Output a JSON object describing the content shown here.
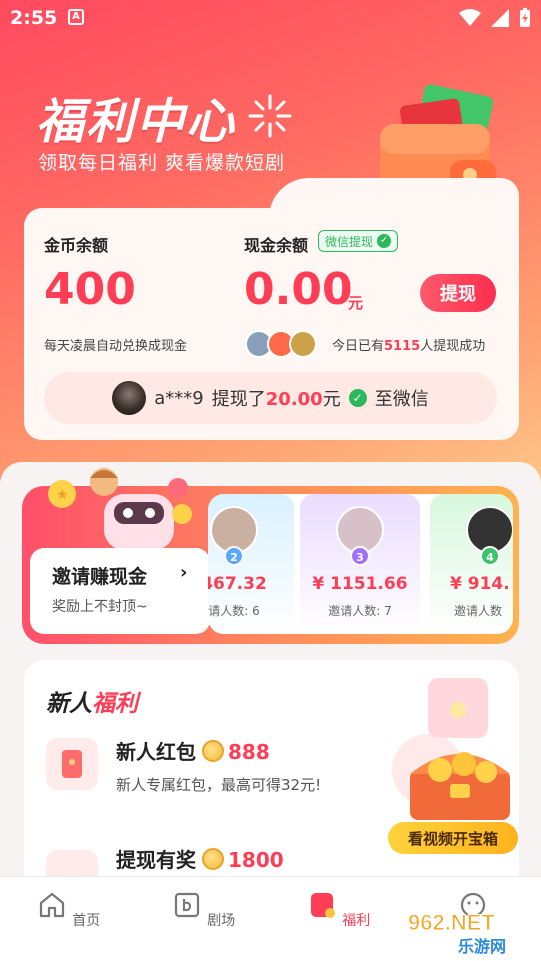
{
  "status_bar": {
    "time": "2:55",
    "a_icon": "A"
  },
  "hero": {
    "title": "福利中心",
    "subtitle": "领取每日福利 爽看爆款短剧"
  },
  "balance": {
    "coin_label": "金币余额",
    "coin_value": "400",
    "coin_note": "每天凌晨自动兑换成现金",
    "cash_label": "现金余额",
    "wechat_badge": "微信提现",
    "cash_value": "0.00",
    "cash_unit": "元",
    "withdraw_button": "提现",
    "social_prefix": "今日已有",
    "social_count": "5115",
    "social_suffix": "人提现成功",
    "ticker_user": "a***9",
    "ticker_mid": "提现了",
    "ticker_amount": "20.00",
    "ticker_unit": "元",
    "ticker_suffix": "至微信"
  },
  "invite": {
    "title": "邀请赚现金",
    "arrow": "›",
    "subtitle": "奖励上不封顶~",
    "cards": [
      {
        "rank": "2",
        "money": "467.32",
        "count": "请人数: 6"
      },
      {
        "rank": "3",
        "money": "¥ 1151.66",
        "count": "邀请人数: 7"
      },
      {
        "rank": "4",
        "money": "¥ 914.",
        "count": "邀请人数"
      }
    ]
  },
  "newbie": {
    "title_black": "新人",
    "title_red": "福利",
    "tasks": [
      {
        "name": "新人红包",
        "reward": "888",
        "desc": "新人专属红包，最高可得32元!"
      },
      {
        "name": "提现有奖",
        "reward": "1800",
        "desc": ""
      }
    ],
    "chest_button": "看视频开宝箱"
  },
  "tabs": [
    {
      "label": "首页",
      "icon": "home-icon"
    },
    {
      "label": "剧场",
      "icon": "theater-icon"
    },
    {
      "label": "福利",
      "icon": "welfare-icon"
    },
    {
      "label": "",
      "icon": "profile-icon"
    }
  ],
  "watermark": {
    "text_top": "962.NET",
    "text_bottom": "乐游网"
  },
  "colors": {
    "accent": "#ff3d55",
    "wechat_green": "#2eb85c",
    "gold": "#ffc53a"
  }
}
